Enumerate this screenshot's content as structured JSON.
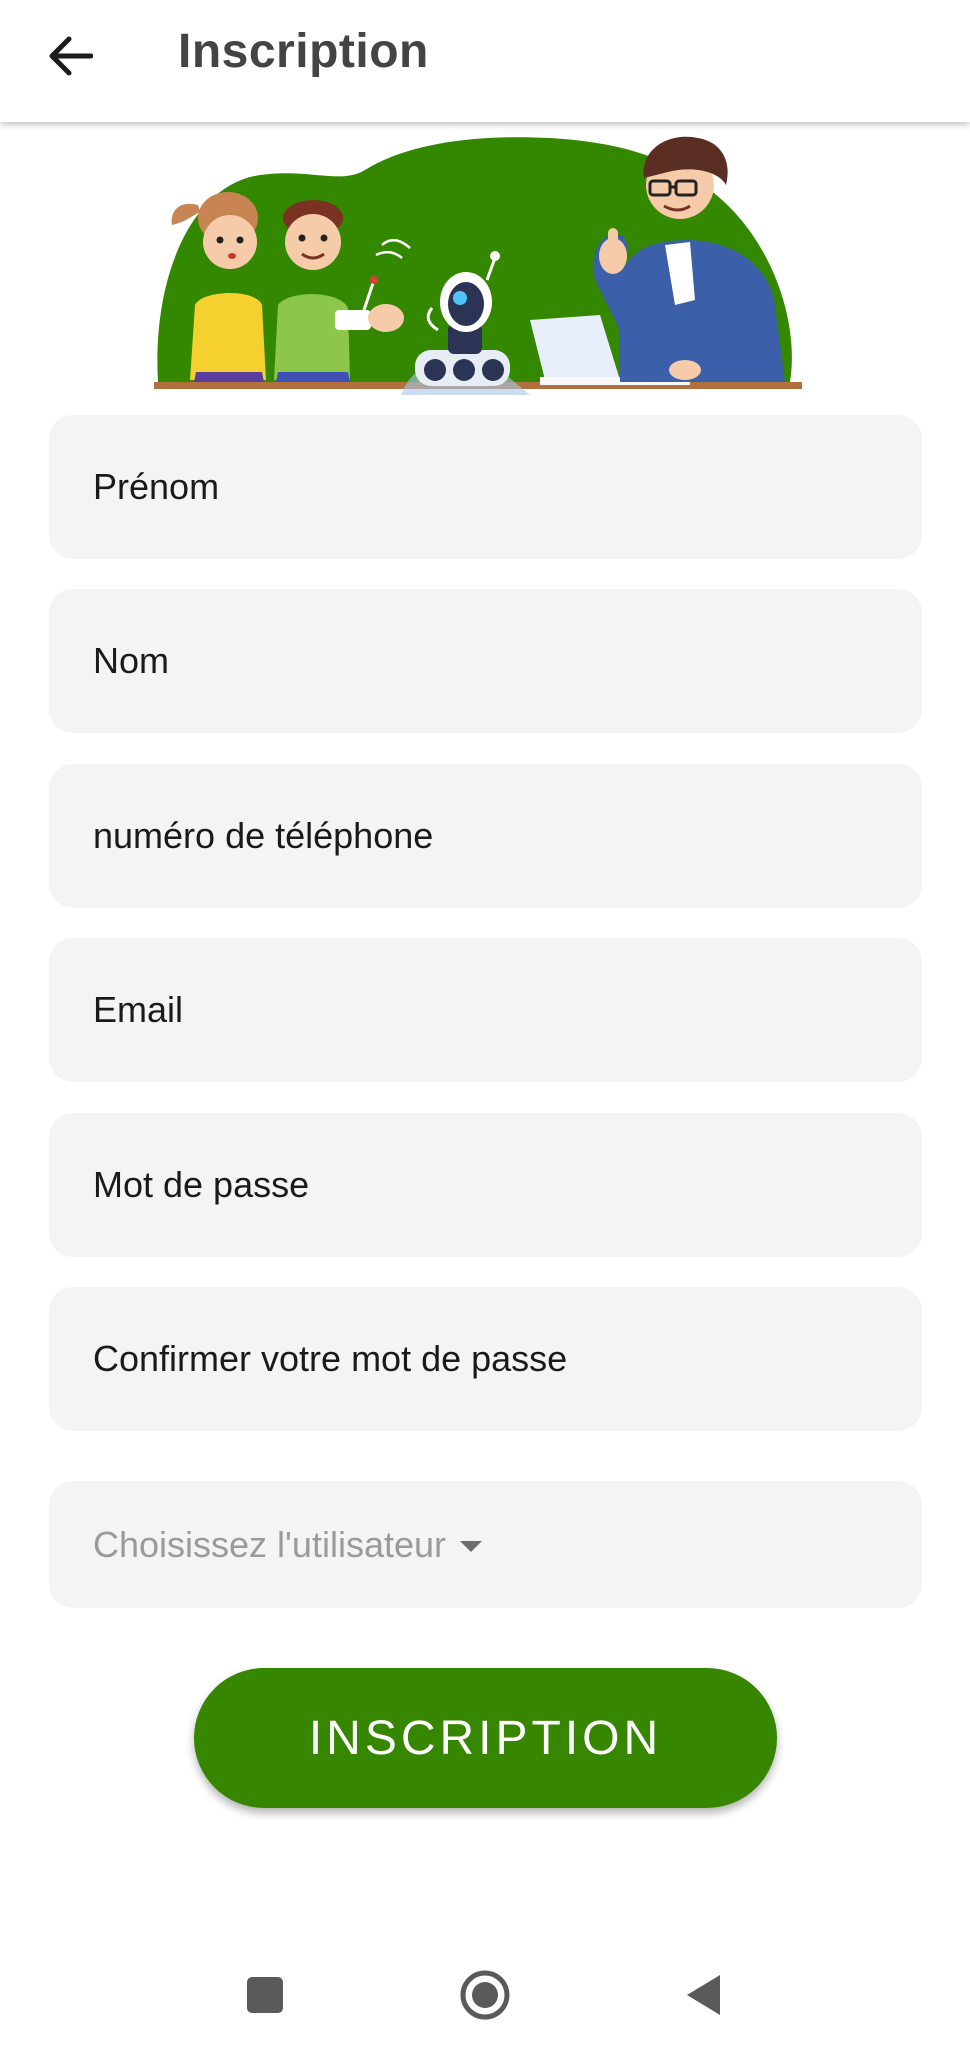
{
  "appbar": {
    "back_icon": "arrow-left-icon",
    "title": "Inscription"
  },
  "hero": {
    "image": "kids-robot-teacher-illustration",
    "accent_color": "#338800"
  },
  "form": {
    "first_name_placeholder": "Prénom",
    "last_name_placeholder": "Nom",
    "phone_placeholder": "numéro de téléphone",
    "email_placeholder": "Email",
    "password_placeholder": "Mot de passe",
    "confirm_password_placeholder": "Confirmer votre mot de passe",
    "user_type_placeholder": "Choisissez l'utilisateur",
    "user_type_icon": "caret-down-icon"
  },
  "submit": {
    "label": "INSCRIPTION",
    "color": "#368600"
  },
  "navbar": {
    "recents_icon": "square-icon",
    "home_icon": "circle-icon",
    "back_icon": "triangle-back-icon"
  }
}
